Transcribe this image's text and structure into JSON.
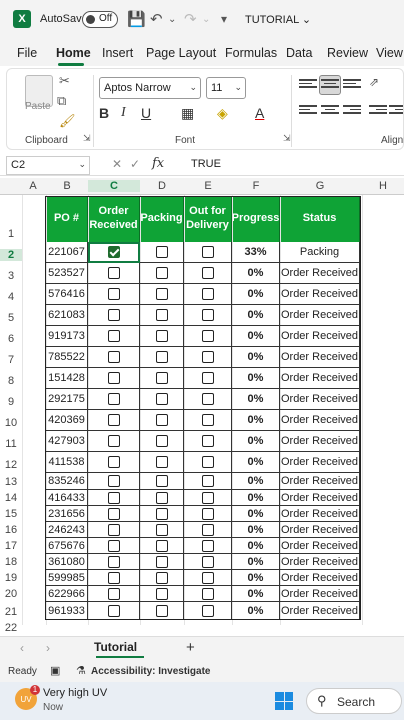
{
  "titlebar": {
    "app_icon": "X",
    "autosave_label": "AutoSave",
    "autosave_state": "Off",
    "title": "TUTORIAL"
  },
  "menu": {
    "tabs": [
      "File",
      "Home",
      "Insert",
      "Page Layout",
      "Formulas",
      "Data",
      "Review",
      "View"
    ],
    "active": "Home"
  },
  "ribbon": {
    "clipboard_label": "Clipboard",
    "paste_label": "Paste",
    "font_label": "Font",
    "alignment_label": "Alignm",
    "font_name": "Aptos Narrow",
    "font_size": "11"
  },
  "formula_bar": {
    "name_box": "C2",
    "fx": "fx",
    "value": "TRUE"
  },
  "columns": [
    "A",
    "B",
    "C",
    "D",
    "E",
    "F",
    "G",
    "H"
  ],
  "rows": [
    "1",
    "2",
    "3",
    "4",
    "5",
    "6",
    "7",
    "8",
    "9",
    "10",
    "11",
    "12",
    "13",
    "14",
    "15",
    "16",
    "17",
    "18",
    "19",
    "20",
    "21",
    "22"
  ],
  "table": {
    "headers": [
      "PO #",
      "Order Received",
      "Packing",
      "Out for Delivery",
      "Progress",
      "Status"
    ],
    "rows": [
      {
        "po": "221067",
        "order_received": true,
        "packing": false,
        "out_for_delivery": false,
        "progress": "33%",
        "status": "Packing"
      },
      {
        "po": "523527",
        "order_received": false,
        "packing": false,
        "out_for_delivery": false,
        "progress": "0%",
        "status": "Order Received"
      },
      {
        "po": "576416",
        "order_received": false,
        "packing": false,
        "out_for_delivery": false,
        "progress": "0%",
        "status": "Order Received"
      },
      {
        "po": "621083",
        "order_received": false,
        "packing": false,
        "out_for_delivery": false,
        "progress": "0%",
        "status": "Order Received"
      },
      {
        "po": "919173",
        "order_received": false,
        "packing": false,
        "out_for_delivery": false,
        "progress": "0%",
        "status": "Order Received"
      },
      {
        "po": "785522",
        "order_received": false,
        "packing": false,
        "out_for_delivery": false,
        "progress": "0%",
        "status": "Order Received"
      },
      {
        "po": "151428",
        "order_received": false,
        "packing": false,
        "out_for_delivery": false,
        "progress": "0%",
        "status": "Order Received"
      },
      {
        "po": "292175",
        "order_received": false,
        "packing": false,
        "out_for_delivery": false,
        "progress": "0%",
        "status": "Order Received"
      },
      {
        "po": "420369",
        "order_received": false,
        "packing": false,
        "out_for_delivery": false,
        "progress": "0%",
        "status": "Order Received"
      },
      {
        "po": "427903",
        "order_received": false,
        "packing": false,
        "out_for_delivery": false,
        "progress": "0%",
        "status": "Order Received"
      },
      {
        "po": "411538",
        "order_received": false,
        "packing": false,
        "out_for_delivery": false,
        "progress": "0%",
        "status": "Order Received"
      },
      {
        "po": "835246",
        "order_received": false,
        "packing": false,
        "out_for_delivery": false,
        "progress": "0%",
        "status": "Order Received"
      },
      {
        "po": "416433",
        "order_received": false,
        "packing": false,
        "out_for_delivery": false,
        "progress": "0%",
        "status": "Order Received"
      },
      {
        "po": "231656",
        "order_received": false,
        "packing": false,
        "out_for_delivery": false,
        "progress": "0%",
        "status": "Order Received"
      },
      {
        "po": "246243",
        "order_received": false,
        "packing": false,
        "out_for_delivery": false,
        "progress": "0%",
        "status": "Order Received"
      },
      {
        "po": "675676",
        "order_received": false,
        "packing": false,
        "out_for_delivery": false,
        "progress": "0%",
        "status": "Order Received"
      },
      {
        "po": "361080",
        "order_received": false,
        "packing": false,
        "out_for_delivery": false,
        "progress": "0%",
        "status": "Order Received"
      },
      {
        "po": "599985",
        "order_received": false,
        "packing": false,
        "out_for_delivery": false,
        "progress": "0%",
        "status": "Order Received"
      },
      {
        "po": "622966",
        "order_received": false,
        "packing": false,
        "out_for_delivery": false,
        "progress": "0%",
        "status": "Order Received"
      },
      {
        "po": "961933",
        "order_received": false,
        "packing": false,
        "out_for_delivery": false,
        "progress": "0%",
        "status": "Order Received"
      }
    ]
  },
  "sheets": {
    "tabs": [
      "Tutorial"
    ],
    "active": "Tutorial",
    "add": "+"
  },
  "statusbar": {
    "ready": "Ready",
    "accessibility": "Accessibility: Investigate"
  },
  "taskbar": {
    "weather_badge": "UV",
    "weather_count": "1",
    "weather_title": "Very high UV",
    "weather_sub": "Now",
    "search_label": "Search"
  },
  "colors": {
    "header_green": "#0fa336",
    "excel_green": "#107c41",
    "checked_green": "#1f6b2e"
  }
}
